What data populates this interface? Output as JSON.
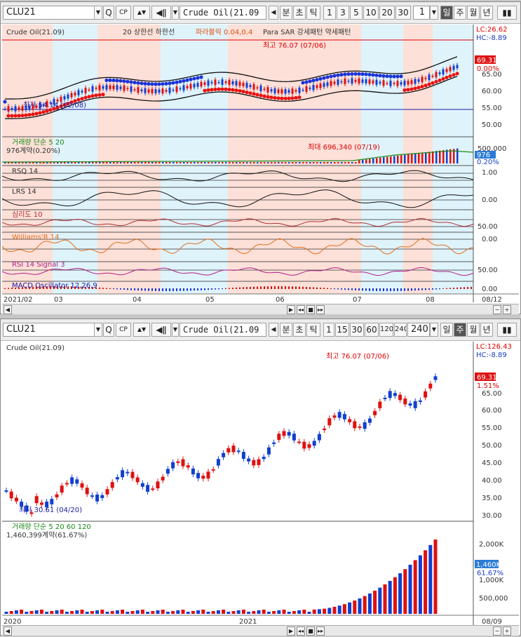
{
  "top": {
    "code": "CLU21",
    "name": "Crude Oil(21.09",
    "tabs": [
      "분",
      "초",
      "틱"
    ],
    "periods": [
      "1",
      "3",
      "5",
      "10",
      "20",
      "30"
    ],
    "period_input": "1",
    "units": [
      "일",
      "주",
      "월",
      "년"
    ],
    "active_unit": "일",
    "legend": {
      "price": "Crude Oil(21.09)",
      "bands": "20  상한선  하한선",
      "sar": "파라볼릭 0.04,0.4",
      "pattern": "Para SAR 강세패턴  약세패턴",
      "high_note": "최고 76.07 (07/06)",
      "low_note": "최저 54.14 (02/08)",
      "volume": "거래량  단순 5  20",
      "volume_sub": "976계약(0.20%)",
      "volume_max": "최대 696,340 (07/19)",
      "rsq": "RSQ 14",
      "lrs": "LRS 14",
      "psy": "심리도 10",
      "willr": "Williams'R 14",
      "rsi": "RSI 14  Signal 3",
      "macd": "MACD Oscillator 12,26,9"
    },
    "right_axis": {
      "lc": "LC:26.62",
      "hc": "HC:-8.89",
      "price_tag": "69.31",
      "pct_tag": "0.00%",
      "price_ticks": [
        "65.00",
        "60.00",
        "55.00",
        "50.00"
      ],
      "vol_ticks": [
        "500,000"
      ],
      "vol_tag": "976",
      "vol_pct": "0.20%",
      "rsq_tick": "1.00",
      "lrs_tick": "0.00",
      "psy_tick": "50.00",
      "willr_tick": "0.00",
      "rsi_tick": "50.00",
      "macd_tick": "0.00"
    },
    "x_labels": [
      "2021/02",
      "03",
      "04",
      "05",
      "06",
      "07",
      "08"
    ],
    "last_date": "08/12"
  },
  "bottom": {
    "code": "CLU21",
    "name": "Crude Oil(21.09",
    "tabs": [
      "분",
      "초",
      "틱"
    ],
    "periods": [
      "1",
      "15",
      "30",
      "60",
      "120",
      "240"
    ],
    "period_input": "240",
    "units": [
      "일",
      "주",
      "월",
      "년"
    ],
    "active_unit": "주",
    "legend": {
      "price": "Crude Oil(21.09)",
      "high_note": "최고 76.07 (07/06)",
      "low_note": "최저 30.61 (04/20)",
      "volume": "거래량  단순 5  20  60  120",
      "volume_sub": "1,460,399계약(61.67%)"
    },
    "right_axis": {
      "lc": "LC:126.43",
      "hc": "HC:-8.89",
      "price_tag": "69.31",
      "pct_tag": "1.51%",
      "price_ticks": [
        "65.00",
        "60.00",
        "55.00",
        "50.00",
        "45.00",
        "40.00",
        "35.00",
        "30.00"
      ],
      "vol_ticks": [
        "2,000K",
        "1,500K",
        "1,000K",
        "500,000"
      ],
      "vol_tag": "1,460K",
      "vol_pct": "61.67%"
    },
    "x_labels": [
      "2020",
      "2021"
    ],
    "last_date": "08/09"
  },
  "colors": {
    "up": "#e01010",
    "down": "#1040d0",
    "band_pink": "#fde0d8",
    "band_blue": "#dff3fb",
    "accent": "#2b7bd6"
  }
}
